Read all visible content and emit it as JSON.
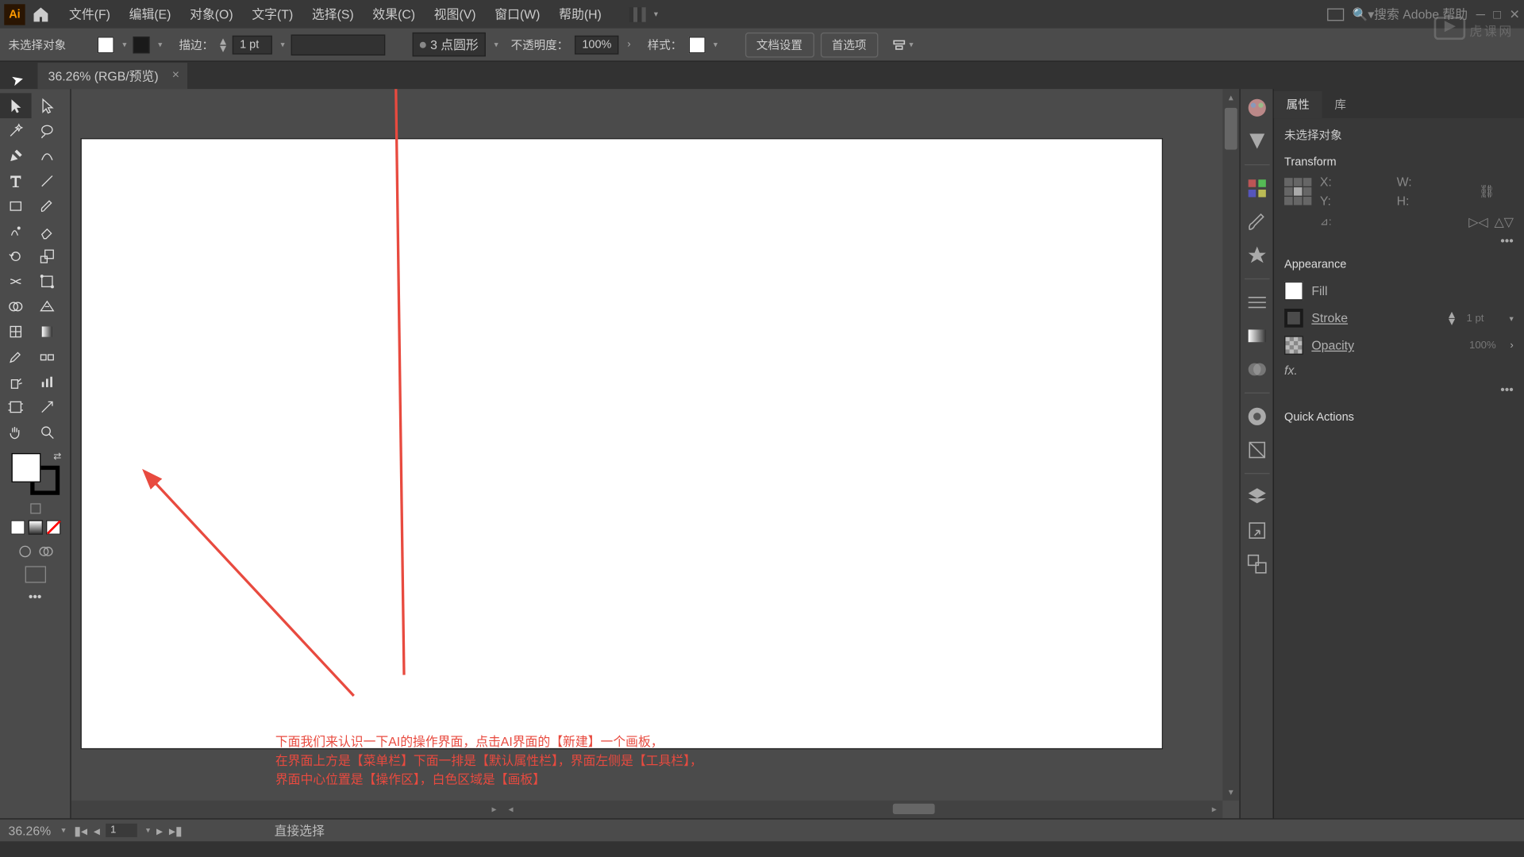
{
  "menu": {
    "file": "文件(F)",
    "edit": "编辑(E)",
    "object": "对象(O)",
    "type": "文字(T)",
    "select": "选择(S)",
    "effect": "效果(C)",
    "view": "视图(V)",
    "window": "窗口(W)",
    "help": "帮助(H)"
  },
  "search_placeholder": "搜索 Adobe 帮助",
  "watermark": "虎课网",
  "options_bar": {
    "no_selection": "未选择对象",
    "stroke_label": "描边：",
    "stroke_weight": "1 pt",
    "brush_preset": "3 点圆形",
    "opacity_label": "不透明度：",
    "opacity_value": "100%",
    "style_label": "样式：",
    "doc_setup": "文档设置",
    "preferences": "首选项"
  },
  "doc_tab": {
    "title": "36.26% (RGB/预览)"
  },
  "annotation": {
    "line1": "下面我们来认识一下AI的操作界面，点击AI界面的【新建】一个画板，",
    "line2": "在界面上方是【菜单栏】下面一排是【默认属性栏】，界面左侧是【工具栏】，",
    "line3": "界面中心位置是【操作区】，白色区域是【画板】"
  },
  "status": {
    "zoom": "36.26%",
    "artboard_num": "1",
    "tool_hint": "直接选择"
  },
  "panels": {
    "tab_properties": "属性",
    "tab_library": "库",
    "no_selection": "未选择对象",
    "transform_title": "Transform",
    "x_label": "X:",
    "y_label": "Y:",
    "w_label": "W:",
    "h_label": "H:",
    "angle_label": "⊿:",
    "appearance_title": "Appearance",
    "fill_label": "Fill",
    "stroke_label": "Stroke",
    "stroke_value": "1 pt",
    "opacity_label": "Opacity",
    "opacity_value": "100%",
    "fx_label": "fx.",
    "quick_actions": "Quick Actions"
  }
}
